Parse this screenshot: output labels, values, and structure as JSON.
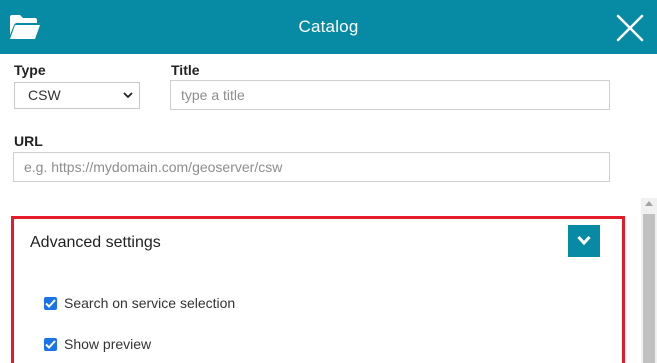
{
  "header": {
    "title": "Catalog",
    "color": "#078aa3",
    "left_icon": "folder-open-icon",
    "close_icon": "close-icon"
  },
  "form": {
    "type_label": "Type",
    "type_value": "CSW",
    "title_label": "Title",
    "title_placeholder": "type a title",
    "title_value": "",
    "url_label": "URL",
    "url_placeholder": "e.g. https://mydomain.com/geoserver/csw",
    "url_value": ""
  },
  "advanced": {
    "title": "Advanced settings",
    "toggle_icon": "chevron-down-icon",
    "highlight_color": "#e31b2b",
    "options": [
      {
        "label": "Search on service selection",
        "checked": true
      },
      {
        "label": "Show preview",
        "checked": true
      }
    ]
  }
}
